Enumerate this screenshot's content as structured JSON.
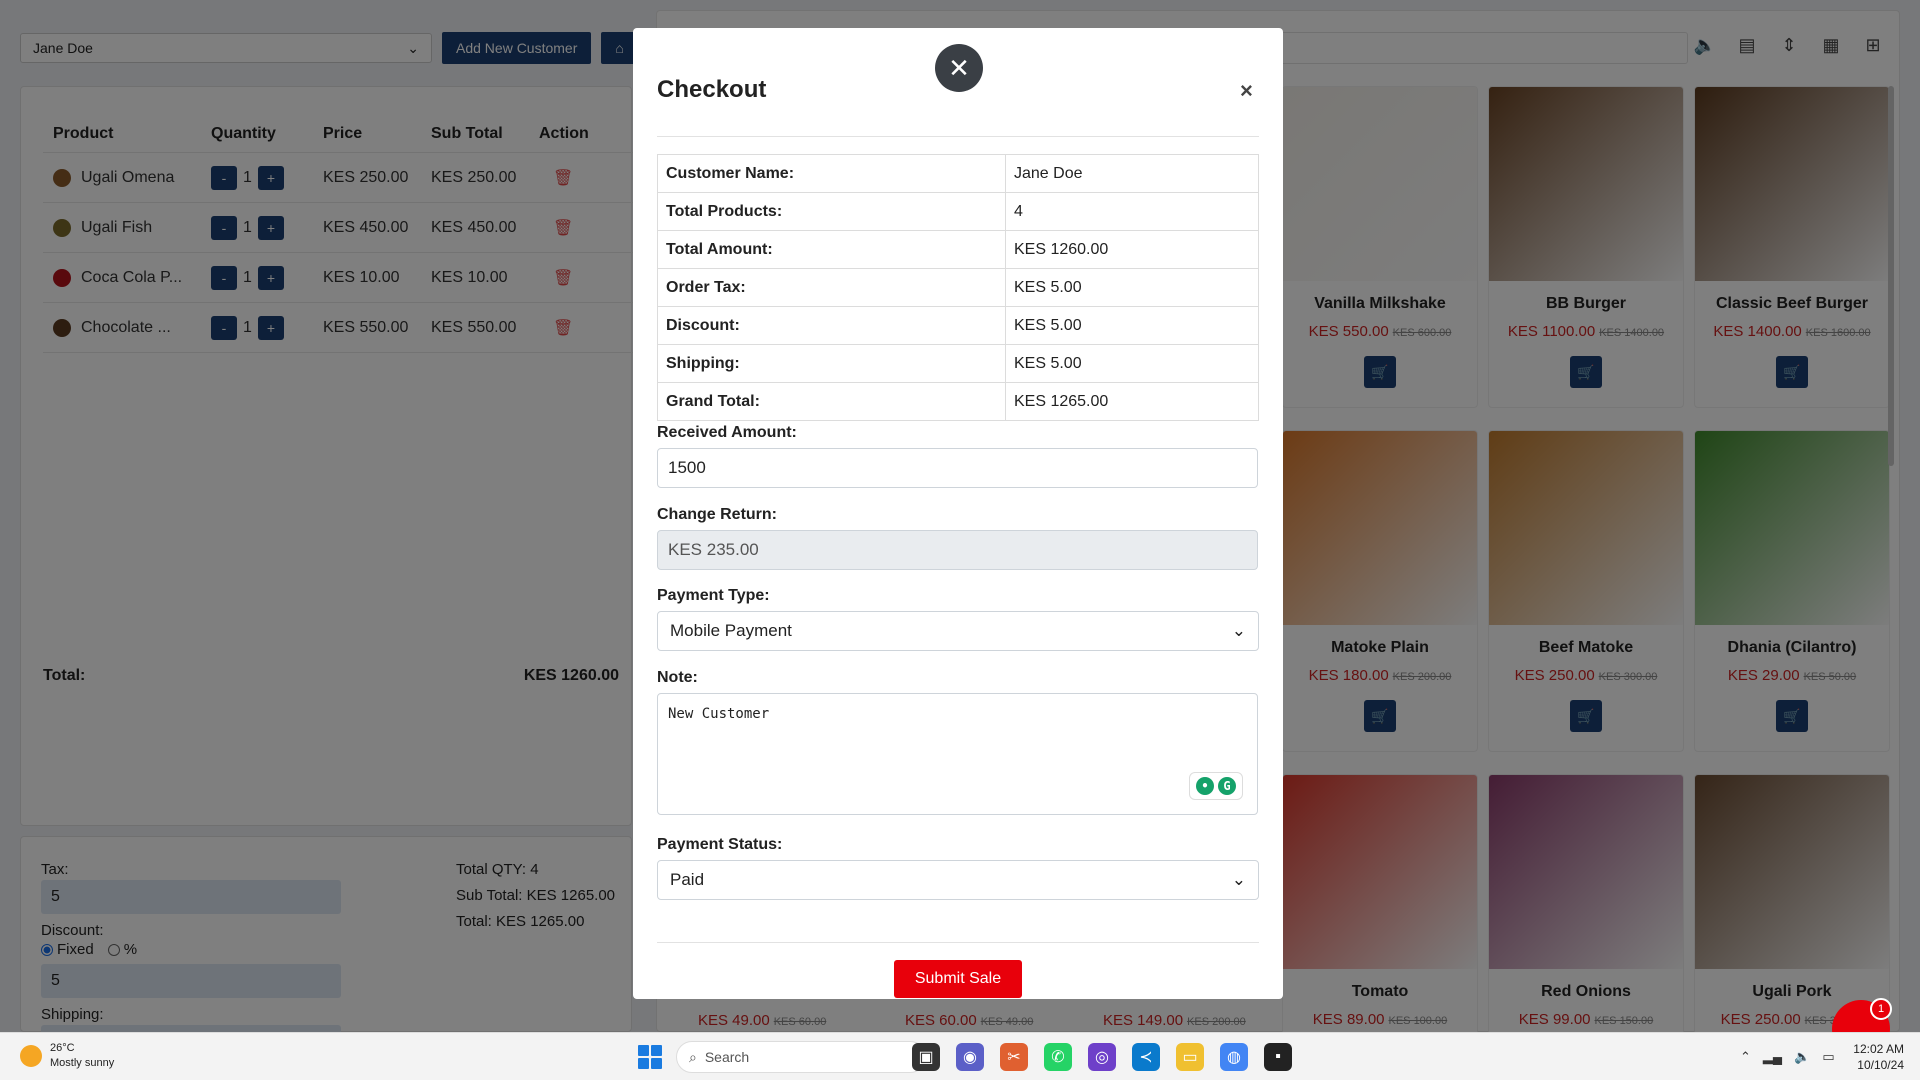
{
  "topbar": {
    "customer": "Jane Doe",
    "add_customer": "Add New Customer",
    "home_icon": "home-icon"
  },
  "cart": {
    "headers": [
      "Product",
      "Quantity",
      "Price",
      "Sub Total",
      "Action"
    ],
    "rows": [
      {
        "name": "Ugali Omena",
        "qty": "1",
        "price": "KES 250.00",
        "subtotal": "KES 250.00",
        "color": "#8a5a2b"
      },
      {
        "name": "Ugali Fish",
        "qty": "1",
        "price": "KES 450.00",
        "subtotal": "KES 450.00",
        "color": "#7a6a2b"
      },
      {
        "name": "Coca Cola P...",
        "qty": "1",
        "price": "KES 10.00",
        "subtotal": "KES 10.00",
        "color": "#b3121b"
      },
      {
        "name": "Chocolate ...",
        "qty": "1",
        "price": "KES 550.00",
        "subtotal": "KES 550.00",
        "color": "#5a3a20"
      }
    ],
    "minus": "-",
    "plus": "+",
    "total_label": "Total:",
    "total_value": "KES 1260.00"
  },
  "adjust": {
    "tax_label": "Tax:",
    "tax_value": "5",
    "discount_label": "Discount:",
    "fixed_label": "Fixed",
    "percent_label": "%",
    "discount_value": "5",
    "shipping_label": "Shipping:",
    "shipping_value": "5",
    "total_qty": "Total QTY: 4",
    "sub_total": "Sub Total: KES 1265.00",
    "total": "Total: KES 1265.00"
  },
  "products": [
    {
      "name": "Vanilla Milkshake",
      "price": "KES 550.00",
      "old": "KES 600.00",
      "color": "#f3f0ea"
    },
    {
      "name": "BB Burger",
      "price": "KES 1100.00",
      "old": "KES 1400.00",
      "color": "#6b4424"
    },
    {
      "name": "Classic Beef Burger",
      "price": "KES 1400.00",
      "old": "KES 1600.00",
      "color": "#5c3a1e"
    },
    {
      "name": "Matoke Plain",
      "price": "KES 180.00",
      "old": "KES 200.00",
      "color": "#d9772a"
    },
    {
      "name": "Beef Matoke",
      "price": "KES 250.00",
      "old": "KES 300.00",
      "color": "#c07a2c"
    },
    {
      "name": "Dhania (Cilantro)",
      "price": "KES 29.00",
      "old": "KES 50.00",
      "color": "#3f8a2c"
    },
    {
      "name": "Tomato",
      "price": "KES 89.00",
      "old": "KES 100.00",
      "color": "#d9362a"
    },
    {
      "name": "Red Onions",
      "price": "KES 99.00",
      "old": "KES 150.00",
      "color": "#8a3a6a"
    },
    {
      "name": "Ugali Pork",
      "price": "KES 250.00",
      "old": "KES 300.00",
      "color": "#6a4a30"
    }
  ],
  "bottom_prices": [
    {
      "price": "KES 49.00",
      "old": "KES 60.00"
    },
    {
      "price": "KES 60.00",
      "old": "KES 49.00"
    },
    {
      "price": "KES 149.00",
      "old": "KES 200.00"
    }
  ],
  "modal": {
    "title": "Checkout",
    "summary": [
      {
        "k": "Customer Name:",
        "v": "Jane Doe"
      },
      {
        "k": "Total Products:",
        "v": "4"
      },
      {
        "k": "Total Amount:",
        "v": "KES 1260.00"
      },
      {
        "k": "Order Tax:",
        "v": "KES 5.00"
      },
      {
        "k": "Discount:",
        "v": "KES 5.00"
      },
      {
        "k": "Shipping:",
        "v": "KES 5.00"
      },
      {
        "k": "Grand Total:",
        "v": "KES 1265.00"
      }
    ],
    "received_label": "Received Amount:",
    "received_value": "1500",
    "change_label": "Change Return:",
    "change_value": "KES 235.00",
    "payment_type_label": "Payment Type:",
    "payment_type_value": "Mobile Payment",
    "note_label": "Note:",
    "note_value": "New Customer",
    "payment_status_label": "Payment Status:",
    "payment_status_value": "Paid",
    "submit": "Submit Sale"
  },
  "chat_badge": "1",
  "taskbar": {
    "temp": "26°C",
    "weather": "Mostly sunny",
    "search": "Search",
    "time": "12:02 AM",
    "date": "10/10/24"
  },
  "colors": {
    "navy": "#1b3f72",
    "red": "#e8000b",
    "price_red": "#c22"
  }
}
